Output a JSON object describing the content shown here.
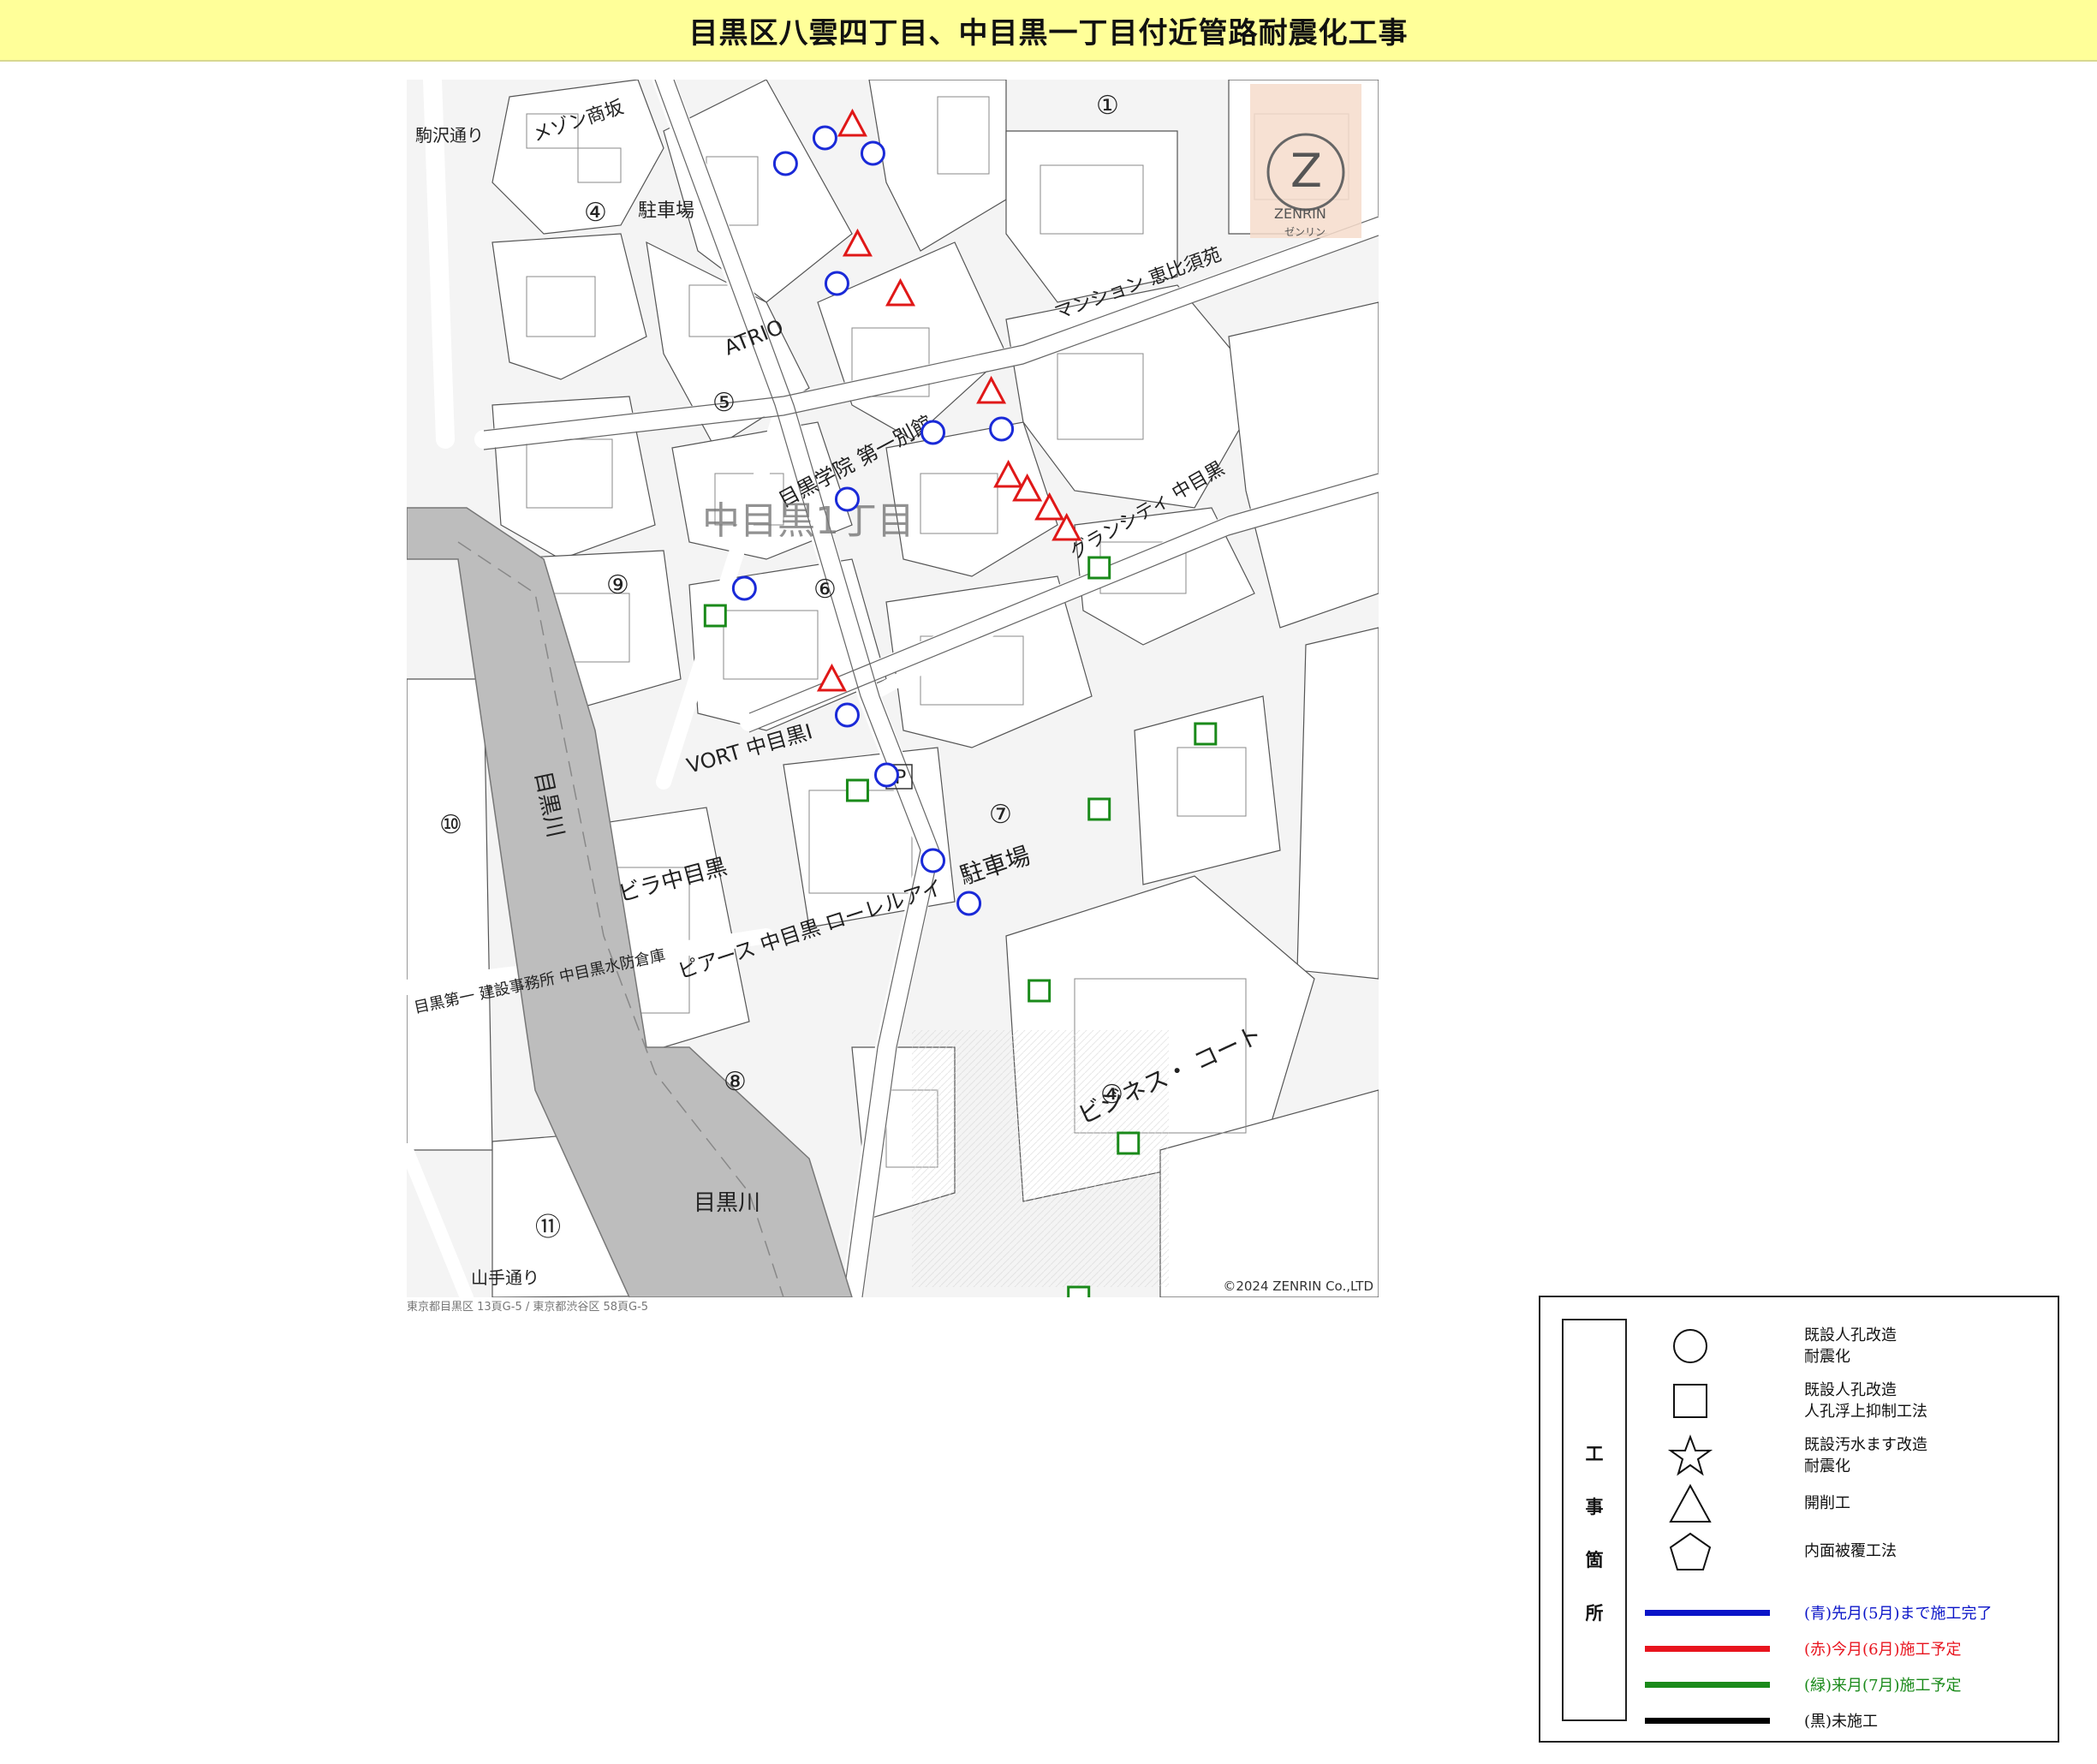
{
  "title": "目黒区八雲四丁目、中目黒一丁目付近管路耐震化工事",
  "map": {
    "copyright": "©2024 ZENRIN Co.,LTD",
    "footer_ref": "東京都目黒区 13頁G-5 / 東京都渋谷区 58頁G-5",
    "watermark_brand": "ZENRIN",
    "watermark_sub": "ゼンリン",
    "district_label": "中目黒1丁目",
    "labels": {
      "komazawa": "駒沢通り",
      "meguro_river_1": "目黒川",
      "meguro_river_2": "目黒川",
      "yamate": "山手通り",
      "atrio": "ATRIO",
      "gakuin": "目黒学院 第一別館",
      "vort": "VORT 中目黒Ⅰ",
      "villa": "ビラ中目黒",
      "pias": "ピアース 中目黒 ローレルアイ",
      "business": "ビジネス・ コート",
      "parking1": "駐車場",
      "parking2": "駐車場",
      "ebisu": "マンション 恵比須苑",
      "grace": "グランシティ 中目黒",
      "mansion": "メゾン商坂",
      "meguro_build": "目黒第一 建設事務所 中目黒水防倉庫",
      "num1": "①",
      "num4a": "④",
      "num4b": "④",
      "num5": "⑤",
      "num6": "⑥",
      "num7": "⑦",
      "num8": "⑧",
      "num9": "⑨",
      "num10": "⑩",
      "num11": "⑪",
      "p_mark": "P"
    }
  },
  "markers": {
    "blue_circles": [
      [
        272,
        43
      ],
      [
        244,
        34
      ],
      [
        221,
        49
      ],
      [
        251,
        119
      ],
      [
        307,
        206
      ],
      [
        347,
        204
      ],
      [
        257,
        245
      ],
      [
        197,
        297
      ],
      [
        257,
        371
      ],
      [
        280,
        406
      ],
      [
        307,
        456
      ],
      [
        328,
        481
      ]
    ],
    "red_triangles": [
      [
        260,
        26
      ],
      [
        263,
        96
      ],
      [
        288,
        125
      ],
      [
        341,
        182
      ],
      [
        351,
        231
      ],
      [
        362,
        239
      ],
      [
        375,
        250
      ],
      [
        385,
        262
      ],
      [
        248,
        350
      ]
    ],
    "green_squares": [
      [
        180,
        313
      ],
      [
        404,
        285
      ],
      [
        263,
        415
      ],
      [
        404,
        426
      ],
      [
        466,
        382
      ],
      [
        369,
        532
      ],
      [
        421,
        621
      ],
      [
        392,
        711
      ],
      [
        357,
        791
      ],
      [
        344,
        858
      ]
    ]
  },
  "legend": {
    "vertical_label": [
      "工",
      "事",
      "箇",
      "所"
    ],
    "items": [
      {
        "shape": "circle",
        "line1": "既設人孔改造",
        "line2": "耐震化"
      },
      {
        "shape": "square",
        "line1": "既設人孔改造",
        "line2": "人孔浮上抑制工法"
      },
      {
        "shape": "star",
        "line1": "既設汚水ます改造",
        "line2": "耐震化"
      },
      {
        "shape": "triangle",
        "line1": "開削工",
        "line2": ""
      },
      {
        "shape": "pentagon",
        "line1": "内面被覆工法",
        "line2": ""
      }
    ],
    "lines": [
      {
        "color": "#0a14c8",
        "label": "(青)先月(5月)まで施工完了"
      },
      {
        "color": "#e8141e",
        "label": "(赤)今月(6月)施工予定"
      },
      {
        "color": "#1a8a1a",
        "label": "(緑)来月(7月)施工予定"
      },
      {
        "color": "#000000",
        "label": "(黒)未施工"
      }
    ]
  }
}
